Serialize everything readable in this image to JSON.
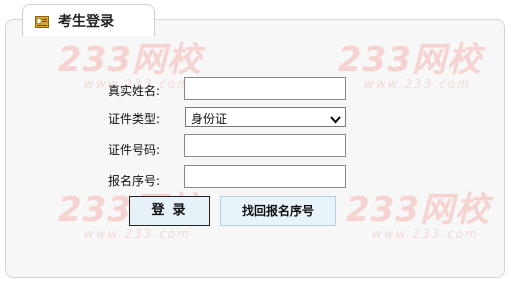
{
  "tab": {
    "title": "考生登录",
    "icon": "id-card-icon"
  },
  "watermark": {
    "text": "233网校",
    "url": "www.233.com"
  },
  "form": {
    "name_label": "真实姓名:",
    "name_value": "",
    "id_type_label": "证件类型:",
    "id_type_selected": "身份证",
    "id_number_label": "证件号码:",
    "id_number_value": "",
    "reg_number_label": "报名序号:",
    "reg_number_value": ""
  },
  "buttons": {
    "login_label": "登录",
    "find_reg_label": "找回报名序号"
  },
  "colors": {
    "panel_bg": "#f7f7f7",
    "watermark": "#f6d3d0",
    "button_bg": "#e6f1f8"
  }
}
